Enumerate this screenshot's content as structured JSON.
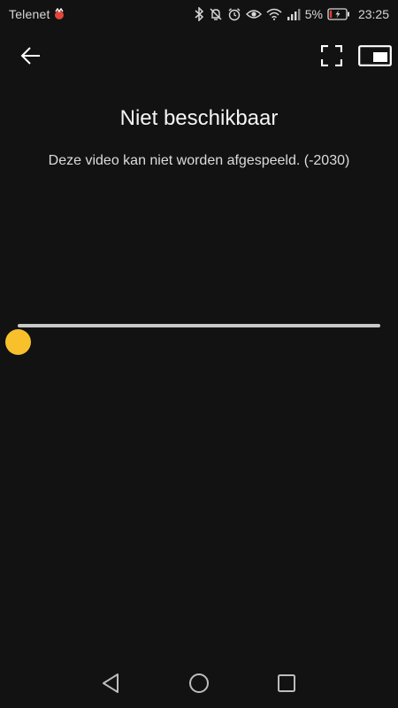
{
  "status_bar": {
    "carrier": "Telenet",
    "battery_percent": "5%",
    "time": "23:25",
    "icons": [
      "carrier-badge-icon",
      "bluetooth-icon",
      "mute-icon",
      "alarm-icon",
      "eye-icon",
      "wifi-icon",
      "signal-icon",
      "battery-icon"
    ]
  },
  "toolbar": {
    "icons": [
      "back-arrow-icon",
      "fullscreen-icon",
      "picture-in-picture-icon"
    ]
  },
  "error": {
    "title": "Niet beschikbaar",
    "message": "Deze video kan niet worden afgespeeld. (-2030)"
  },
  "player": {
    "progress": 0,
    "accent_color": "#f8c12c",
    "track_color": "#c8c8c8"
  },
  "nav_bar": {
    "icons": [
      "triangle-back-icon",
      "circle-home-icon",
      "square-recents-icon"
    ]
  },
  "colors": {
    "background": "#121212",
    "text": "#ffffff",
    "battery_low": "#e53935"
  }
}
